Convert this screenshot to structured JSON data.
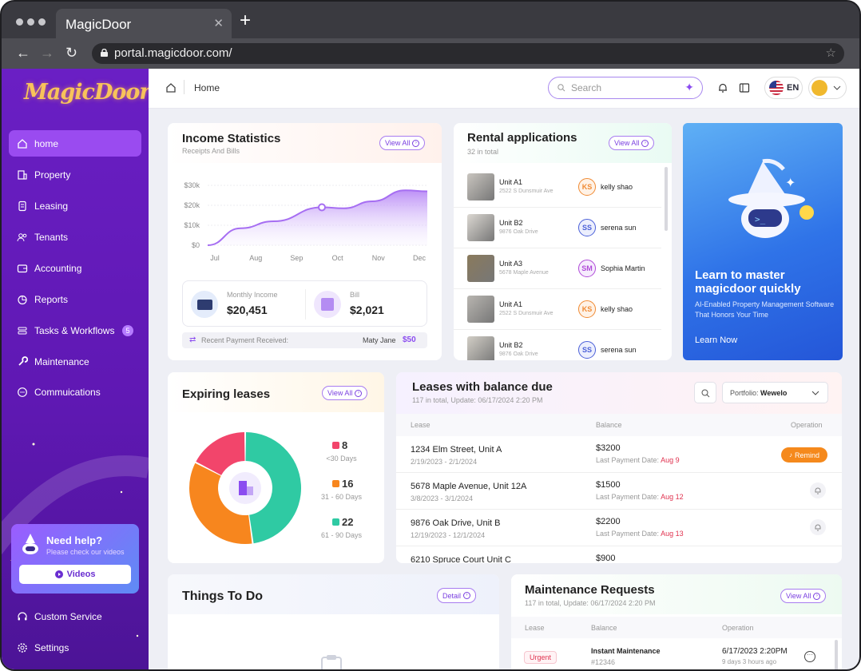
{
  "browser": {
    "tab_title": "MagicDoor",
    "url": "portal.magicdoor.com/"
  },
  "sidebar": {
    "logo": "MagicDoor",
    "items": [
      {
        "label": "home",
        "icon": "home-icon",
        "active": true
      },
      {
        "label": "Property",
        "icon": "building-icon"
      },
      {
        "label": "Leasing",
        "icon": "document-icon"
      },
      {
        "label": "Tenants",
        "icon": "users-icon"
      },
      {
        "label": "Accounting",
        "icon": "wallet-icon"
      },
      {
        "label": "Reports",
        "icon": "chart-pie-icon"
      },
      {
        "label": "Tasks & Workflows",
        "icon": "stack-icon",
        "badge": "5"
      },
      {
        "label": "Maintenance",
        "icon": "wrench-icon"
      },
      {
        "label": "Commuications",
        "icon": "chat-icon"
      }
    ],
    "help": {
      "title": "Need help?",
      "subtitle": "Please check our videos",
      "button": "Videos"
    },
    "bottom_items": [
      {
        "label": "Custom Service",
        "icon": "headset-icon"
      },
      {
        "label": "Settings",
        "icon": "gear-icon"
      }
    ]
  },
  "topbar": {
    "breadcrumb": "Home",
    "search_placeholder": "Search",
    "language": "EN"
  },
  "income": {
    "title": "Income Statistics",
    "subtitle": "Receipts And Bills",
    "view_all": "View All",
    "monthly_income_label": "Monthly Income",
    "monthly_income": "$20,451",
    "bill_label": "Bill",
    "bill": "$2,021",
    "recent_label": "Recent Payment Received:",
    "recent_name": "Maty Jane",
    "recent_amount": "$50"
  },
  "chart_data": {
    "type": "area",
    "x": [
      "Jul",
      "Aug",
      "Sep",
      "Oct",
      "Nov",
      "Dec"
    ],
    "y_ticks": [
      "$0",
      "$10k",
      "$20k",
      "$30k"
    ],
    "ylim": [
      0,
      30000
    ],
    "series": [
      {
        "values": [
          0,
          8500,
          12000,
          19000,
          18500,
          22000,
          27500,
          27000
        ],
        "x_pos": [
          0,
          0.15,
          0.3,
          0.52,
          0.62,
          0.75,
          0.9,
          1.0
        ]
      }
    ],
    "highlight_point": {
      "x": "Oct",
      "y": 19000
    },
    "color": "#a66ef2"
  },
  "rental": {
    "title": "Rental applications",
    "subtitle": "32 in total",
    "view_all": "View All",
    "rows": [
      {
        "unit": "Unit A1",
        "addr": "2522 S Dunsmuir Ave",
        "initials": "KS",
        "name": "kelly shao",
        "color": "#f08a33",
        "bg": "#fff2e6"
      },
      {
        "unit": "Unit B2",
        "addr": "9876 Oak Drive",
        "initials": "SS",
        "name": "serena sun",
        "color": "#4a5fd8",
        "bg": "#eceffd"
      },
      {
        "unit": "Unit A3",
        "addr": "5678 Maple Avenue",
        "initials": "SM",
        "name": "Sophia Martin",
        "color": "#b04ad8",
        "bg": "#f6ecfd"
      },
      {
        "unit": "Unit A1",
        "addr": "2522 S Dunsmuir Ave",
        "initials": "KS",
        "name": "kelly shao",
        "color": "#f08a33",
        "bg": "#fff2e6"
      },
      {
        "unit": "Unit B2",
        "addr": "9876 Oak Drive",
        "initials": "SS",
        "name": "serena sun",
        "color": "#4a5fd8",
        "bg": "#eceffd"
      }
    ]
  },
  "promo": {
    "title_line1": "Learn to master",
    "title_line2": "magicdoor quickly",
    "desc": "AI-Enabled Property Management Software That Honors Your Time",
    "link": "Learn Now"
  },
  "expiring": {
    "title": "Expiring leases",
    "view_all": "View All",
    "segments": [
      {
        "count": "8",
        "label": "<30 Days",
        "value": 8,
        "color": "#f2456b"
      },
      {
        "count": "16",
        "label": "31 - 60 Days",
        "value": 16,
        "color": "#f7861e"
      },
      {
        "count": "22",
        "label": "61 - 90 Days",
        "value": 22,
        "color": "#2fcaa3"
      }
    ]
  },
  "leases": {
    "title": "Leases with balance due",
    "subtitle": "117 in total, Update: 06/17/2024 2:20 PM",
    "portfolio_label": "Portfolio:",
    "portfolio_value": "Wewelo",
    "col_lease": "Lease",
    "col_balance": "Balance",
    "col_operation": "Operation",
    "remind_label": "Remind",
    "rows": [
      {
        "addr": "1234 Elm Street, Unit A",
        "dates": "2/19/2023 - 2/1/2024",
        "balance": "$3200",
        "pay_label": "Last Payment Date:",
        "pay_date": "Aug 9"
      },
      {
        "addr": "5678 Maple Avenue, Unit 12A",
        "dates": "3/8/2023 - 3/1/2024",
        "balance": "$1500",
        "pay_label": "Last Payment Date:",
        "pay_date": "Aug 12"
      },
      {
        "addr": "9876 Oak Drive, Unit B",
        "dates": "12/19/2023 - 12/1/2024",
        "balance": "$2200",
        "pay_label": "Last Payment Date:",
        "pay_date": "Aug 13"
      },
      {
        "addr": "6210 Spruce Court Unit C",
        "dates": "",
        "balance": "$900",
        "pay_label": "",
        "pay_date": ""
      }
    ]
  },
  "todo": {
    "title": "Things To Do",
    "detail": "Detail"
  },
  "maintenance": {
    "title": "Maintenance Requests",
    "subtitle": "117 in total, Update: 06/17/2024 2:20 PM",
    "view_all": "View All",
    "col_lease": "Lease",
    "col_balance": "Balance",
    "col_operation": "Operation",
    "row": {
      "priority": "Urgent",
      "name": "Instant Maintenance",
      "id": "#12346",
      "date": "6/17/2023 2:20PM",
      "ago": "9 days 3 hours ago"
    }
  }
}
